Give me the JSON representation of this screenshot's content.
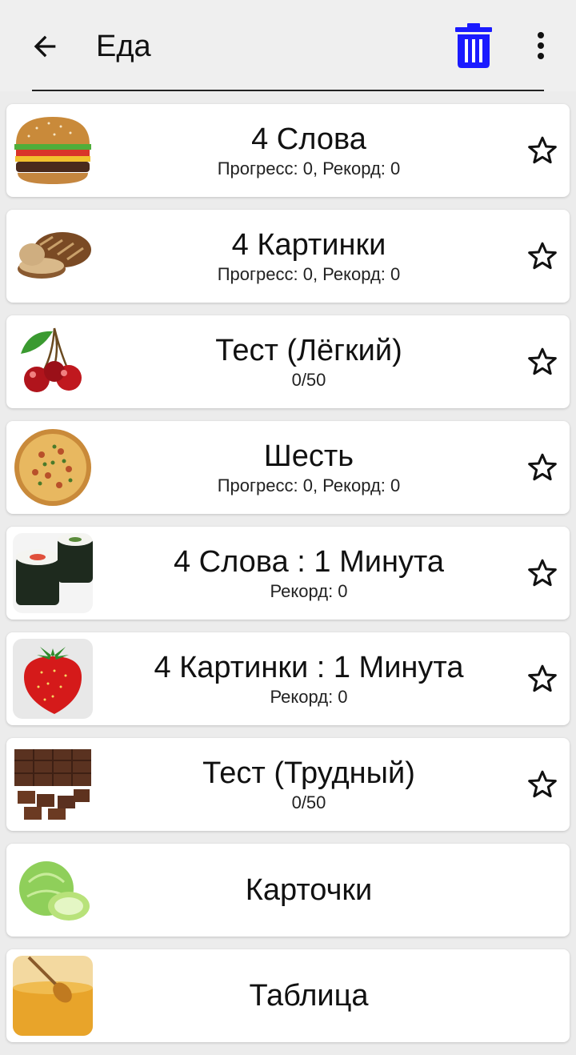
{
  "header": {
    "title": "Еда",
    "icons": {
      "back": "arrow-left-icon",
      "delete": "trash-icon",
      "menu": "more-vert-icon"
    },
    "accent_color": "#1a1aff"
  },
  "items": [
    {
      "title": "4 Слова",
      "subtitle": "Прогресс: 0, Рекорд: 0",
      "image": "burger",
      "starred": false
    },
    {
      "title": "4 Картинки",
      "subtitle": "Прогресс: 0, Рекорд: 0",
      "image": "bread",
      "starred": false
    },
    {
      "title": "Тест (Лёгкий)",
      "subtitle": "0/50",
      "image": "cherries",
      "starred": false
    },
    {
      "title": "Шесть",
      "subtitle": "Прогресс: 0, Рекорд: 0",
      "image": "pizza",
      "starred": false
    },
    {
      "title": "4 Слова : 1 Минута",
      "subtitle": "Рекорд: 0",
      "image": "sushi",
      "starred": false
    },
    {
      "title": "4 Картинки : 1 Минута",
      "subtitle": "Рекорд: 0",
      "image": "strawberry",
      "starred": false
    },
    {
      "title": "Тест (Трудный)",
      "subtitle": "0/50",
      "image": "chocolate",
      "starred": false
    },
    {
      "title": "Карточки",
      "image": "cabbage"
    },
    {
      "title": "Таблица",
      "image": "honey"
    }
  ]
}
